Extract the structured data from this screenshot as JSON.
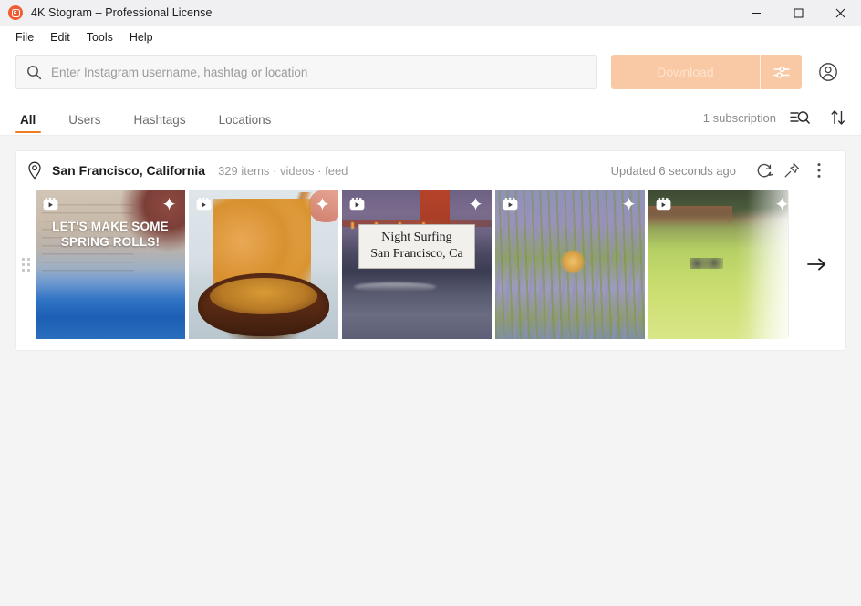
{
  "window": {
    "title": "4K Stogram – Professional License",
    "app_icon": "instagram-camera-icon",
    "controls": {
      "minimize": "minimize-icon",
      "maximize": "maximize-icon",
      "close": "close-icon"
    }
  },
  "menubar": {
    "items": [
      {
        "label": "File"
      },
      {
        "label": "Edit"
      },
      {
        "label": "Tools"
      },
      {
        "label": "Help"
      }
    ]
  },
  "search": {
    "icon": "search-icon",
    "placeholder": "Enter Instagram username, hashtag or location",
    "value": "",
    "download_label": "Download",
    "download_enabled": false,
    "download_options_icon": "sliders-icon",
    "account_icon": "account-circle-icon",
    "accent_color": "#f9c9a6"
  },
  "tabs": {
    "items": [
      {
        "label": "All",
        "active": true
      },
      {
        "label": "Users",
        "active": false
      },
      {
        "label": "Hashtags",
        "active": false
      },
      {
        "label": "Locations",
        "active": false
      }
    ],
    "subscription_count": "1 subscription",
    "filter_icon": "filter-search-icon",
    "sort_icon": "sort-arrows-icon",
    "active_underline_color": "#f07c24"
  },
  "subscription_card": {
    "type_icon": "location-pin-icon",
    "title": "San Francisco, California",
    "meta": "329 items · videos · feed",
    "updated": "Updated 6 seconds ago",
    "refresh_icon": "refresh-icon",
    "pin_icon": "pushpin-icon",
    "more_icon": "more-vertical-icon",
    "drag_handle_icon": "drag-handle-icon",
    "next_arrow_icon": "arrow-right-icon",
    "thumbnails": [
      {
        "media_type": "video",
        "badge_icon": "video-reel-icon",
        "sparkle_icon": "sparkle-icon",
        "overlay_text": "LET'S MAKE SOME SPRING ROLLS!",
        "alt": "hands preparing spring rolls over a blue cooler"
      },
      {
        "media_type": "video",
        "badge_icon": "video-reel-icon",
        "sparkle_icon": "sparkle-icon",
        "overlay_text": "",
        "alt": "chopsticks lifting noodles from a dark bowl"
      },
      {
        "media_type": "video",
        "badge_icon": "video-reel-icon",
        "sparkle_icon": "sparkle-icon",
        "caption_line1": "Night Surfing",
        "caption_line2": "San Francisco, Ca",
        "alt": "Golden Gate Bridge at dusk over surf"
      },
      {
        "media_type": "video",
        "badge_icon": "video-reel-icon",
        "sparkle_icon": "sparkle-icon",
        "overlay_text": "",
        "alt": "butterfly on lavender field"
      },
      {
        "media_type": "video",
        "badge_icon": "video-reel-icon",
        "sparkle_icon": "sparkle-icon",
        "overlay_text": "",
        "alt": "foggy green meadow with trees"
      }
    ]
  }
}
